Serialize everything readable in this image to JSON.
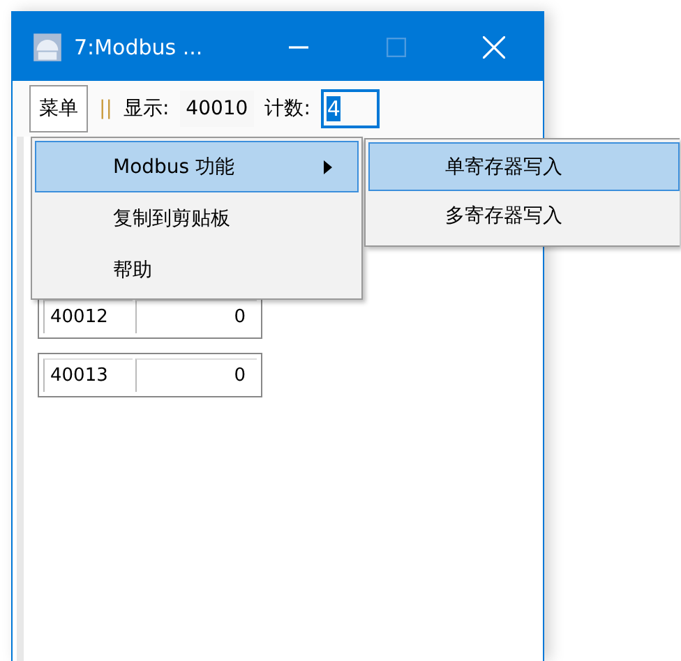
{
  "window": {
    "title": "7:Modbus ...",
    "maximize_disabled": true
  },
  "toolbar": {
    "menu_button": {
      "label": "菜单",
      "pressed": true
    },
    "separator": "||",
    "display_label": "显示:",
    "display_value": "40010",
    "count_label": "计数:",
    "count_value": "4"
  },
  "registers": [
    {
      "address": "40012",
      "value": "0"
    },
    {
      "address": "40013",
      "value": "0"
    }
  ],
  "context_menu": {
    "items": [
      {
        "label": "Modbus 功能",
        "has_submenu": true,
        "selected": true
      },
      {
        "label": "复制到剪贴板",
        "has_submenu": false,
        "selected": false
      },
      {
        "label": "帮助",
        "has_submenu": false,
        "selected": false
      }
    ]
  },
  "submenu": {
    "items": [
      {
        "label": "单寄存器写入",
        "selected": true
      },
      {
        "label": "多寄存器写入",
        "selected": false
      }
    ]
  }
}
